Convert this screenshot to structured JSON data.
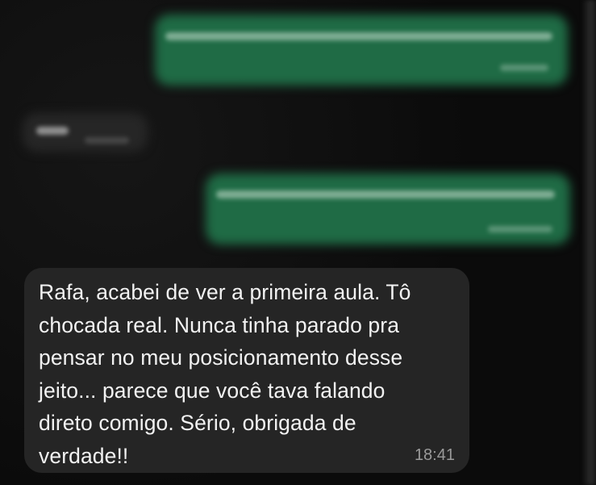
{
  "conversation": {
    "incoming_message": {
      "text": "Rafa, acabei de ver a primeira aula. Tô\nchocada real. Nunca tinha parado pra\npensar no meu posicionamento desse\njeito... parece que você tava falando\ndireto comigo. Sério, obrigada de\nverdade!!",
      "time": "18:41"
    },
    "blurred_messages": [
      {
        "direction": "outgoing"
      },
      {
        "direction": "incoming"
      },
      {
        "direction": "outgoing"
      }
    ]
  },
  "colors": {
    "background": "#0b0b0b",
    "incoming_bubble": "#252525",
    "outgoing_bubble": "#1f6b45",
    "text": "#f2f2f2",
    "timestamp": "#9a9a9a"
  }
}
